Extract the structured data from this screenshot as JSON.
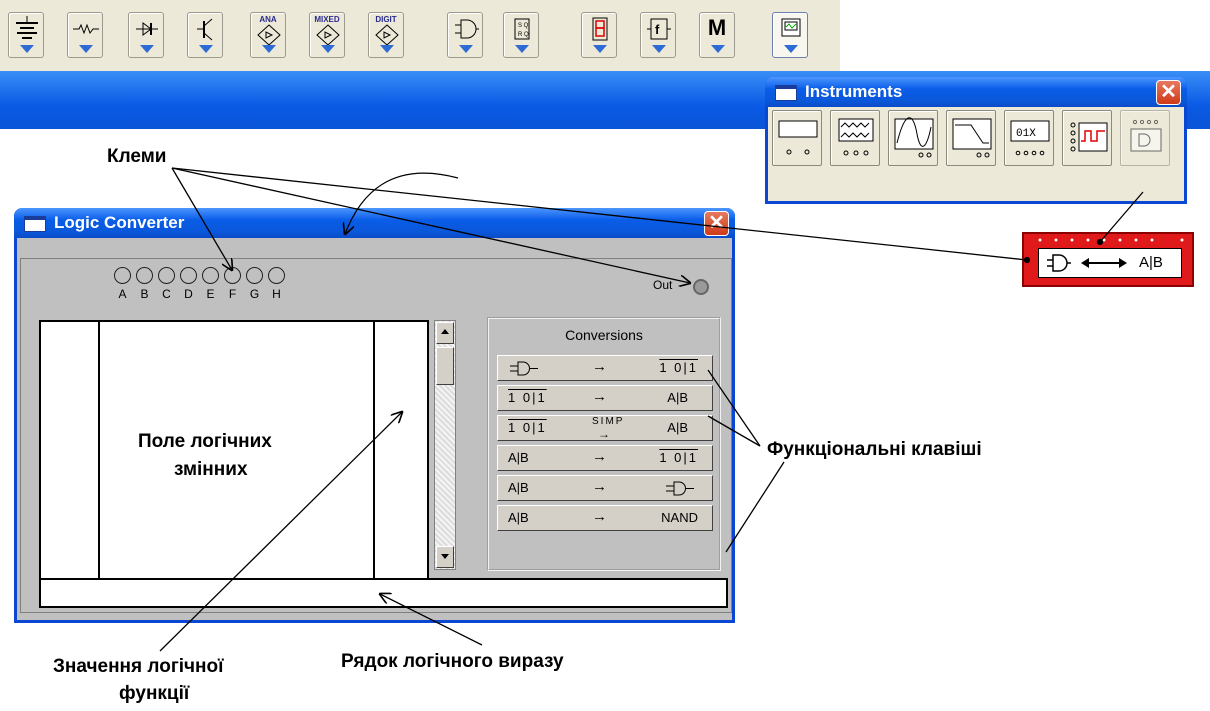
{
  "toolbar": {
    "buttons": [
      {
        "name": "sources",
        "label": ""
      },
      {
        "name": "basic",
        "label": ""
      },
      {
        "name": "diodes",
        "label": ""
      },
      {
        "name": "transistors",
        "label": ""
      },
      {
        "name": "analog-ics",
        "label": "ANA"
      },
      {
        "name": "mixed-ics",
        "label": "MIXED"
      },
      {
        "name": "digital-ics",
        "label": "DIGIT"
      },
      {
        "name": "logic-gates",
        "label": ""
      },
      {
        "name": "digital",
        "label": ""
      },
      {
        "name": "indicators",
        "label": ""
      },
      {
        "name": "controls",
        "label": ""
      },
      {
        "name": "miscellaneous",
        "label": "M"
      },
      {
        "name": "instruments",
        "label": ""
      }
    ]
  },
  "instruments_window": {
    "title": "Instruments",
    "close_glyph": "✕"
  },
  "logic_converter_icon": {
    "text": "A|B"
  },
  "logic_converter": {
    "title": "Logic Converter",
    "close_glyph": "✕",
    "terminals": [
      "A",
      "B",
      "C",
      "D",
      "E",
      "F",
      "G",
      "H"
    ],
    "out_label": "Out",
    "conversions_title": "Conversions",
    "conversions": [
      {
        "left": "gate",
        "arrow": "→",
        "right": "1 0|1"
      },
      {
        "left": "1 0|1",
        "arrow": "→",
        "right": "A|B"
      },
      {
        "left": "1 0|1",
        "arrow": "SIMP",
        "right": "A|B"
      },
      {
        "left": "A|B",
        "arrow": "→",
        "right": "1 0|1"
      },
      {
        "left": "A|B",
        "arrow": "→",
        "right": "gate"
      },
      {
        "left": "A|B",
        "arrow": "→",
        "right": "NAND"
      }
    ]
  },
  "annotations": {
    "terminals": "Клеми",
    "variables_field_1": "Поле логічних",
    "variables_field_2": "змінних",
    "function_keys": "Функціональні клавіші",
    "function_value_1": "Значення логічної",
    "function_value_2": "функції",
    "expression_row": "Рядок логічного виразу"
  },
  "colors": {
    "xp_title": "#0a5de8",
    "panel": "#c0c0c0",
    "icon_red": "#e01a1a",
    "toolbar_arrow": "#2e6bd4"
  }
}
